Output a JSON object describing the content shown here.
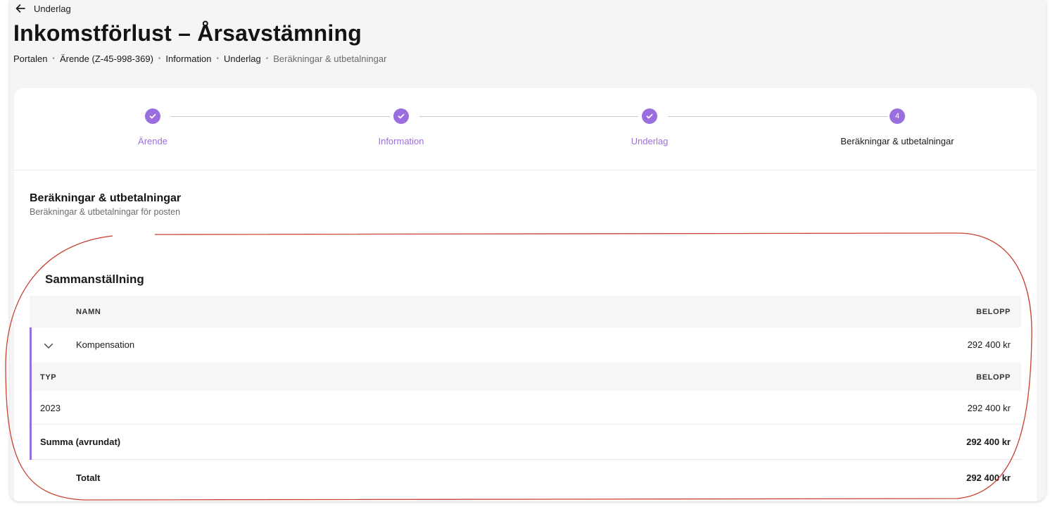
{
  "header": {
    "back_label": "Underlag",
    "title": "Inkomstförlust – Årsavstämning"
  },
  "breadcrumb": [
    "Portalen",
    "Ärende (Z-45-998-369)",
    "Information",
    "Underlag",
    "Beräkningar & utbetalningar"
  ],
  "stepper": {
    "steps": [
      {
        "label": "Ärende",
        "state": "done"
      },
      {
        "label": "Information",
        "state": "done"
      },
      {
        "label": "Underlag",
        "state": "done"
      },
      {
        "label": "Beräkningar & utbetalningar",
        "state": "active",
        "number": "4"
      }
    ]
  },
  "section": {
    "title": "Beräkningar & utbetalningar",
    "subtitle": "Beräkningar & utbetalningar för posten"
  },
  "summary": {
    "title": "Sammanställning",
    "columns": {
      "name": "NAMN",
      "amount": "BELOPP"
    },
    "group": {
      "name": "Kompensation",
      "amount": "292 400 kr",
      "sub_columns": {
        "type": "TYP",
        "amount": "BELOPP"
      },
      "rows": [
        {
          "type": "2023",
          "amount": "292 400 kr"
        }
      ],
      "sum_label": "Summa (avrundat)",
      "sum_amount": "292 400 kr"
    },
    "total_label": "Totalt",
    "total_amount": "292 400 kr"
  },
  "colors": {
    "accent": "#9b6ee0",
    "annotation": "#c8412e"
  }
}
